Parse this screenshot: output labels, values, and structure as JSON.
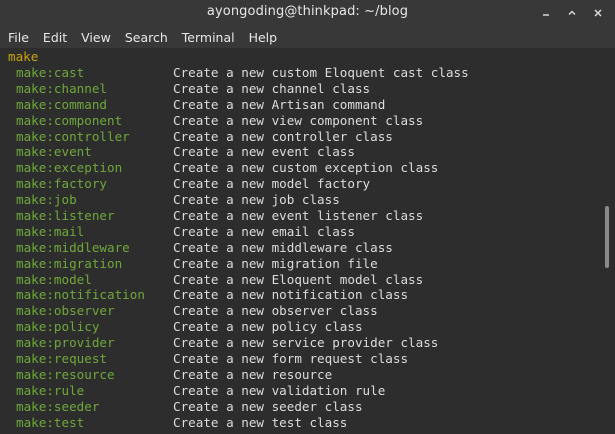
{
  "window": {
    "title": "ayongoding@thinkpad: ~/blog"
  },
  "controls": {
    "minimize_icon": "minimize-icon",
    "maximize_icon": "maximize-icon",
    "close_icon": "close-icon"
  },
  "menu": {
    "file": "File",
    "edit": "Edit",
    "view": "View",
    "search": "Search",
    "terminal": "Terminal",
    "help": "Help"
  },
  "terminal": {
    "header": "make",
    "rows": [
      {
        "cmd": "make:cast",
        "desc": "Create a new custom Eloquent cast class"
      },
      {
        "cmd": "make:channel",
        "desc": "Create a new channel class"
      },
      {
        "cmd": "make:command",
        "desc": "Create a new Artisan command"
      },
      {
        "cmd": "make:component",
        "desc": "Create a new view component class"
      },
      {
        "cmd": "make:controller",
        "desc": "Create a new controller class"
      },
      {
        "cmd": "make:event",
        "desc": "Create a new event class"
      },
      {
        "cmd": "make:exception",
        "desc": "Create a new custom exception class"
      },
      {
        "cmd": "make:factory",
        "desc": "Create a new model factory"
      },
      {
        "cmd": "make:job",
        "desc": "Create a new job class"
      },
      {
        "cmd": "make:listener",
        "desc": "Create a new event listener class"
      },
      {
        "cmd": "make:mail",
        "desc": "Create a new email class"
      },
      {
        "cmd": "make:middleware",
        "desc": "Create a new middleware class"
      },
      {
        "cmd": "make:migration",
        "desc": "Create a new migration file"
      },
      {
        "cmd": "make:model",
        "desc": "Create a new Eloquent model class"
      },
      {
        "cmd": "make:notification",
        "desc": "Create a new notification class"
      },
      {
        "cmd": "make:observer",
        "desc": "Create a new observer class"
      },
      {
        "cmd": "make:policy",
        "desc": "Create a new policy class"
      },
      {
        "cmd": "make:provider",
        "desc": "Create a new service provider class"
      },
      {
        "cmd": "make:request",
        "desc": "Create a new form request class"
      },
      {
        "cmd": "make:resource",
        "desc": "Create a new resource"
      },
      {
        "cmd": "make:rule",
        "desc": "Create a new validation rule"
      },
      {
        "cmd": "make:seeder",
        "desc": "Create a new seeder class"
      },
      {
        "cmd": "make:test",
        "desc": "Create a new test class"
      }
    ]
  },
  "colors": {
    "background": "#2d2d2d",
    "titlebar": "#383838",
    "header_text": "#c7a30c",
    "command_text": "#6fa83a",
    "description_text": "#dcdcdc"
  }
}
